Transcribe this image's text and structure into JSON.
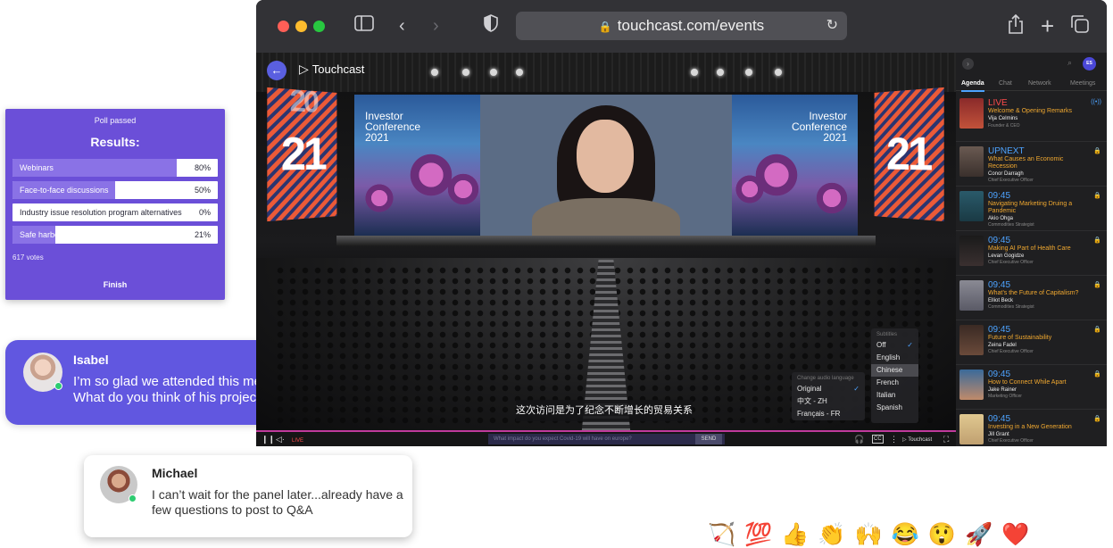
{
  "poll": {
    "status": "Poll passed",
    "heading": "Results:",
    "options": [
      {
        "label": "Webinars",
        "percent": "80%",
        "fraction": 0.8
      },
      {
        "label": "Face-to-face discussions",
        "percent": "50%",
        "fraction": 0.5
      },
      {
        "label": "Industry issue resolution program alternatives",
        "percent": "0%",
        "fraction": 0.0
      },
      {
        "label": "Safe harbor elections",
        "percent": "21%",
        "fraction": 0.21
      }
    ],
    "votes": "617 votes",
    "finish_label": "Finish"
  },
  "chat": {
    "isabel": {
      "name": "Isabel",
      "message": "I’m so glad we attended this meeting! What do you think of his projections?"
    },
    "michael": {
      "name": "Michael",
      "message": "I can’t wait for the panel later...already have a few questions to post to Q&A"
    }
  },
  "reactions": [
    "🏹",
    "💯",
    "👍",
    "👏",
    "🙌",
    "😂",
    "😲",
    "🚀",
    "❤️"
  ],
  "browser": {
    "url": "touchcast.com/events",
    "icons": {
      "back": "chevron-left-icon",
      "forward": "chevron-right-icon",
      "share": "share-icon",
      "new_tab": "plus-icon",
      "tabs": "tabs-icon"
    }
  },
  "stage": {
    "brand": "Touchcast",
    "side_number": "21",
    "side_number_top": "20",
    "screen_title_lines": [
      "Investor",
      "Conference",
      "2021"
    ],
    "caption": "这次访问是为了纪念不断增长的贸易关系",
    "audio_menu": {
      "header": "Change audio language",
      "options": [
        "Original",
        "中文 - ZH",
        "Français - FR"
      ],
      "selected": "Original"
    },
    "subtitle_menu": {
      "header": "Subtitles",
      "options": [
        "Off",
        "English",
        "Chinese",
        "French",
        "Italian",
        "Spanish"
      ],
      "selected": "Off",
      "highlighted": "Chinese"
    },
    "controls": {
      "live_label": "LIVE",
      "ask_placeholder": "What impact do you expect Covid-19 will have on europe?",
      "send_label": "SEND",
      "cc_label": "CC",
      "brand_label": "Touchcast"
    }
  },
  "agenda": {
    "user_initials": "ES",
    "tabs": [
      "Agenda",
      "Chat",
      "Network",
      "Meetings"
    ],
    "active_tab": "Agenda",
    "items": [
      {
        "time": "LIVE",
        "title": "Welcome & Opening Remarks",
        "person": "Vija Celmins",
        "role": "Founder & CEO"
      },
      {
        "time": "UPNEXT",
        "title": "What Causes an Economic Recession",
        "person": "Conor Darragh",
        "role": "Chief Executive Officer"
      },
      {
        "time": "09:45",
        "title": "Navigating Marketing Druing a Pandemic",
        "person": "Akio Ohga",
        "role": "Commodities Strategist"
      },
      {
        "time": "09:45",
        "title": "Making AI Part of Health Care",
        "person": "Levan Gogidze",
        "role": "Chief Executive Officer"
      },
      {
        "time": "09:45",
        "title": "What’s the Future of Capitalism?",
        "person": "Elliot Beck",
        "role": "Commodities Strategist"
      },
      {
        "time": "09:45",
        "title": "Future of Sustainability",
        "person": "Zeina Fadel",
        "role": "Chief Executive Officer"
      },
      {
        "time": "09:45",
        "title": "How to Connect While Apart",
        "person": "Jake Rainer",
        "role": "Marketing Officer"
      },
      {
        "time": "09:45",
        "title": "Investing in a New Generation",
        "person": "Jill Grant",
        "role": "Chief Executive Officer"
      }
    ]
  },
  "colors": {
    "poll_bg": "#6b4fd8",
    "isabel_bubble": "#6157e0",
    "agenda_accent": "#4da3ff",
    "agenda_title": "#f0a830",
    "live_red": "#ff4b4b"
  }
}
